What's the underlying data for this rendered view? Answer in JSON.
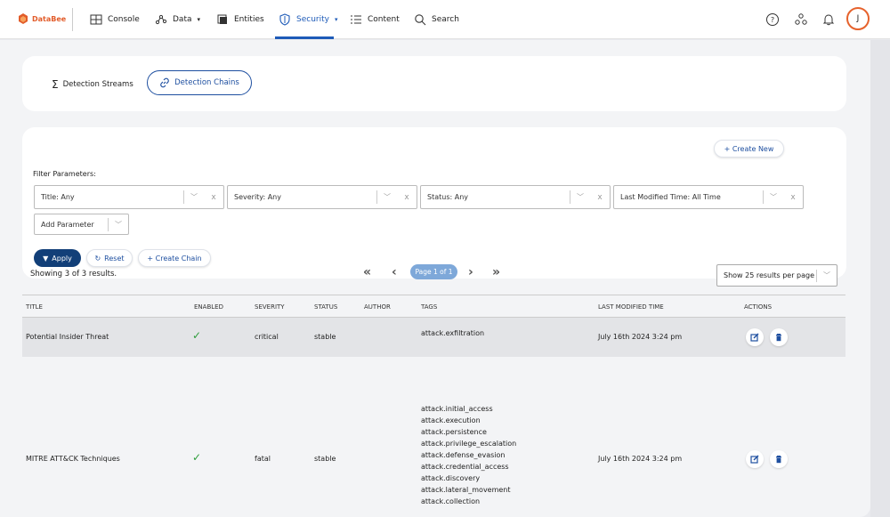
{
  "brand": {
    "name": "DataBee",
    "accent": "#1e5bb8",
    "logo_color": "#e25c2a"
  },
  "nav": {
    "items": [
      {
        "label": "Console",
        "icon": "grid-icon",
        "caret": false
      },
      {
        "label": "Data",
        "icon": "data-flow-icon",
        "caret": true
      },
      {
        "label": "Entities",
        "icon": "entities-icon",
        "caret": false
      },
      {
        "label": "Security",
        "icon": "shield-icon",
        "caret": true,
        "active": true
      },
      {
        "label": "Content",
        "icon": "list-icon",
        "caret": false
      },
      {
        "label": "Search",
        "icon": "search-icon",
        "caret": false
      }
    ],
    "right_icons": [
      "help-icon",
      "network-icon",
      "bell-icon"
    ],
    "avatar_initial": "J"
  },
  "subtabs": {
    "streams_label": "Detection Streams",
    "chains_label": "Detection Chains",
    "active": "chains"
  },
  "filters": {
    "create_new_label": "+ Create New",
    "label": "Filter Parameters:",
    "selects": [
      {
        "value": "Title: Any"
      },
      {
        "value": "Severity: Any"
      },
      {
        "value": "Status: Any"
      },
      {
        "value": "Last Modified Time: All Time"
      }
    ],
    "add_parameter": "Add Parameter",
    "apply_label": "Apply",
    "reset_label": "Reset",
    "create_chain_label": "+ Create Chain"
  },
  "results": {
    "showing": "Showing 3 of 3 results.",
    "page_label": "Page 1 of 1",
    "per_page": "Show 25 results per page"
  },
  "table": {
    "columns": [
      "TITLE",
      "ENABLED",
      "SEVERITY",
      "STATUS",
      "AUTHOR",
      "TAGS",
      "LAST MODIFIED TIME",
      "ACTIONS"
    ],
    "rows": [
      {
        "title": "Potential Insider Threat",
        "enabled": true,
        "severity": "critical",
        "status": "stable",
        "author": "",
        "tags": [
          "attack.exfiltration"
        ],
        "modified": "July 16th 2024 3:24 pm"
      },
      {
        "title": "MITRE ATT&CK Techniques",
        "enabled": true,
        "severity": "fatal",
        "status": "stable",
        "author": "",
        "tags": [
          "attack.initial_access",
          "attack.execution",
          "attack.persistence",
          "attack.privilege_escalation",
          "attack.defense_evasion",
          "attack.credential_access",
          "attack.discovery",
          "attack.lateral_movement",
          "attack.collection"
        ],
        "modified": "July 16th 2024 3:24 pm"
      }
    ]
  }
}
